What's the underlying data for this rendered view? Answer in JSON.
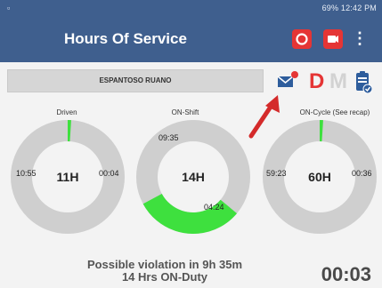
{
  "status_bar": {
    "left_icon": "notification-icon",
    "right_text": "69% 12:42 PM"
  },
  "app_bar": {
    "title": "Hours Of Service",
    "icons": [
      "lifebuoy-icon",
      "video-camera-icon",
      "overflow-menu-icon"
    ],
    "more_glyph": "⋮"
  },
  "driver": {
    "name": "ESPANTOSO RUANO"
  },
  "toolbar_icons": {
    "mail": "mail-icon",
    "d_label": "D",
    "m_label": "M",
    "clipboard": "clipboard-check-icon"
  },
  "gauges": [
    {
      "label": "Driven",
      "center": "11H",
      "left_value": "10:55",
      "right_value": "00:04",
      "fraction_used": 0.01
    },
    {
      "label": "ON-Shift",
      "center": "14H",
      "top_value": "09:35",
      "bottom_value": "04:24",
      "fraction_used": 0.31
    },
    {
      "label": "ON-Cycle (See recap)",
      "center": "60H",
      "left_value": "59:23",
      "right_value": "00:36",
      "fraction_used": 0.01
    }
  ],
  "violation": {
    "line1": "Possible violation in 9h 35m",
    "line2": "14 Hrs ON-Duty"
  },
  "timer": "00:03",
  "colors": {
    "app_bar": "#3f5f8e",
    "ring": "#cfcfcf",
    "used": "#3ee03e",
    "alert": "#e53535"
  }
}
